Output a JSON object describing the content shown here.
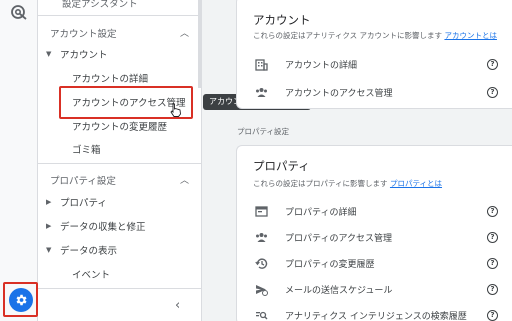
{
  "nav": {
    "top_cut_item": "設定アシスタント",
    "account_section": "アカウント設定",
    "account_group": "アカウント",
    "account_items": [
      "アカウントの詳細",
      "アカウントのアクセス管理",
      "アカウントの変更履歴",
      "ゴミ箱"
    ],
    "property_section": "プロパティ設定",
    "property_groups": [
      "プロパティ",
      "データの収集と修正",
      "データの表示"
    ],
    "property_sub_item": "イベント"
  },
  "tooltip": "アカウントのアクセス管理",
  "account_card": {
    "title": "アカウント",
    "subtitle": "これらの設定はアナリティクス アカウントに影響します",
    "link": "アカウントとは",
    "rows": [
      "アカウントの詳細",
      "アカウントのアクセス管理"
    ]
  },
  "property_section_label": "プロパティ設定",
  "property_card": {
    "title": "プロパティ",
    "subtitle": "これらの設定はプロパティに影響します",
    "link": "プロパティとは",
    "rows": [
      "プロパティの詳細",
      "プロパティのアクセス管理",
      "プロパティの変更履歴",
      "メールの送信スケジュール",
      "アナリティクス インテリジェンスの検索履歴"
    ]
  },
  "colors": {
    "accent": "#1a73e8",
    "highlight": "#d93025"
  }
}
